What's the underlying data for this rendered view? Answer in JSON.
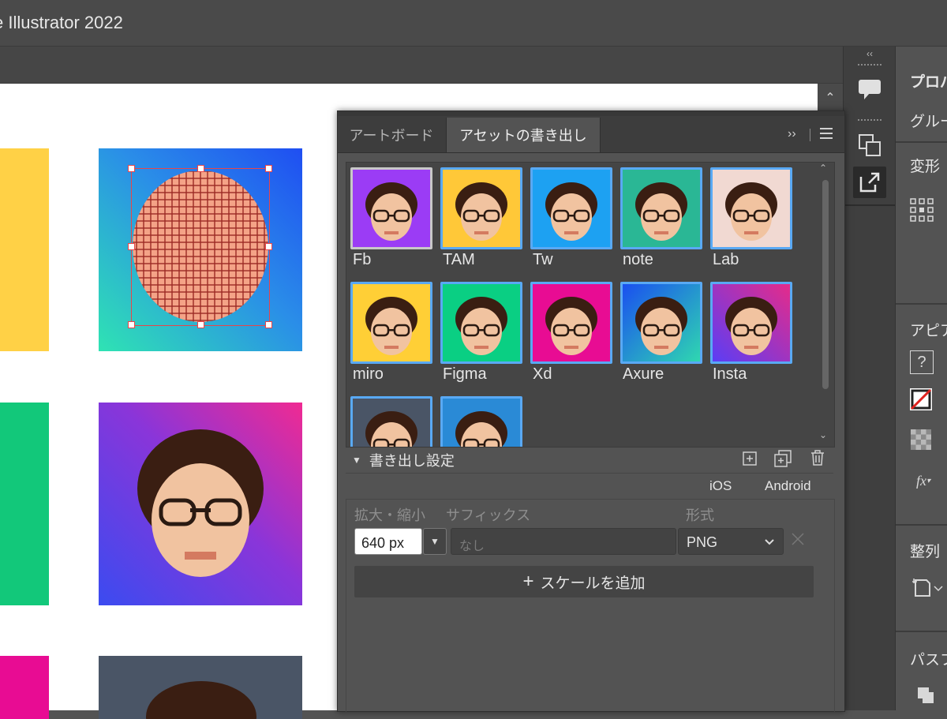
{
  "window": {
    "title": "e Illustrator 2022"
  },
  "colors": {
    "selection": "#e8454a",
    "asset_border": "#59a9f4",
    "panel_bg": "#535353"
  },
  "export_panel": {
    "tabs": [
      {
        "label": "アートボード"
      },
      {
        "label": "アセットの書き出し"
      }
    ],
    "collapse_icon": "double-chevron-right-icon",
    "menu_icon": "hamburger-menu-icon",
    "assets": [
      {
        "label": "Fb",
        "bg": "#9b3cf5"
      },
      {
        "label": "TAM",
        "bg": "#ffc838"
      },
      {
        "label": "Tw",
        "bg": "#1da1f2"
      },
      {
        "label": "note",
        "bg": "#2ab795"
      },
      {
        "label": "Lab",
        "bg": "#f1d9d2"
      },
      {
        "label": "miro",
        "bg": "#ffcf36"
      },
      {
        "label": "Figma",
        "bg": "#0acf83"
      },
      {
        "label": "Xd",
        "bg": "#e80c93"
      },
      {
        "label": "Axure",
        "bg": "linear-gradient(135deg,#1a4ff0,#2fd7b0)"
      },
      {
        "label": "Insta",
        "bg": "linear-gradient(45deg,#5b3df5,#e52b8a)"
      },
      {
        "label": "",
        "bg": "#4a5566"
      },
      {
        "label": "",
        "bg": "#2a8ad6"
      }
    ],
    "export_settings": {
      "heading": "書き出し設定",
      "platforms": [
        "iOS",
        "Android"
      ],
      "col_scale": "拡大・縮小",
      "col_suffix": "サフィックス",
      "col_format": "形式",
      "scale_value": "640 px",
      "suffix_placeholder": "なし",
      "format_value": "PNG",
      "add_scale": "スケールを追加"
    }
  },
  "properties_panel": {
    "sections": [
      "プロパ",
      "グルー",
      "変形",
      "アピア",
      "整列",
      "パスフ"
    ]
  }
}
